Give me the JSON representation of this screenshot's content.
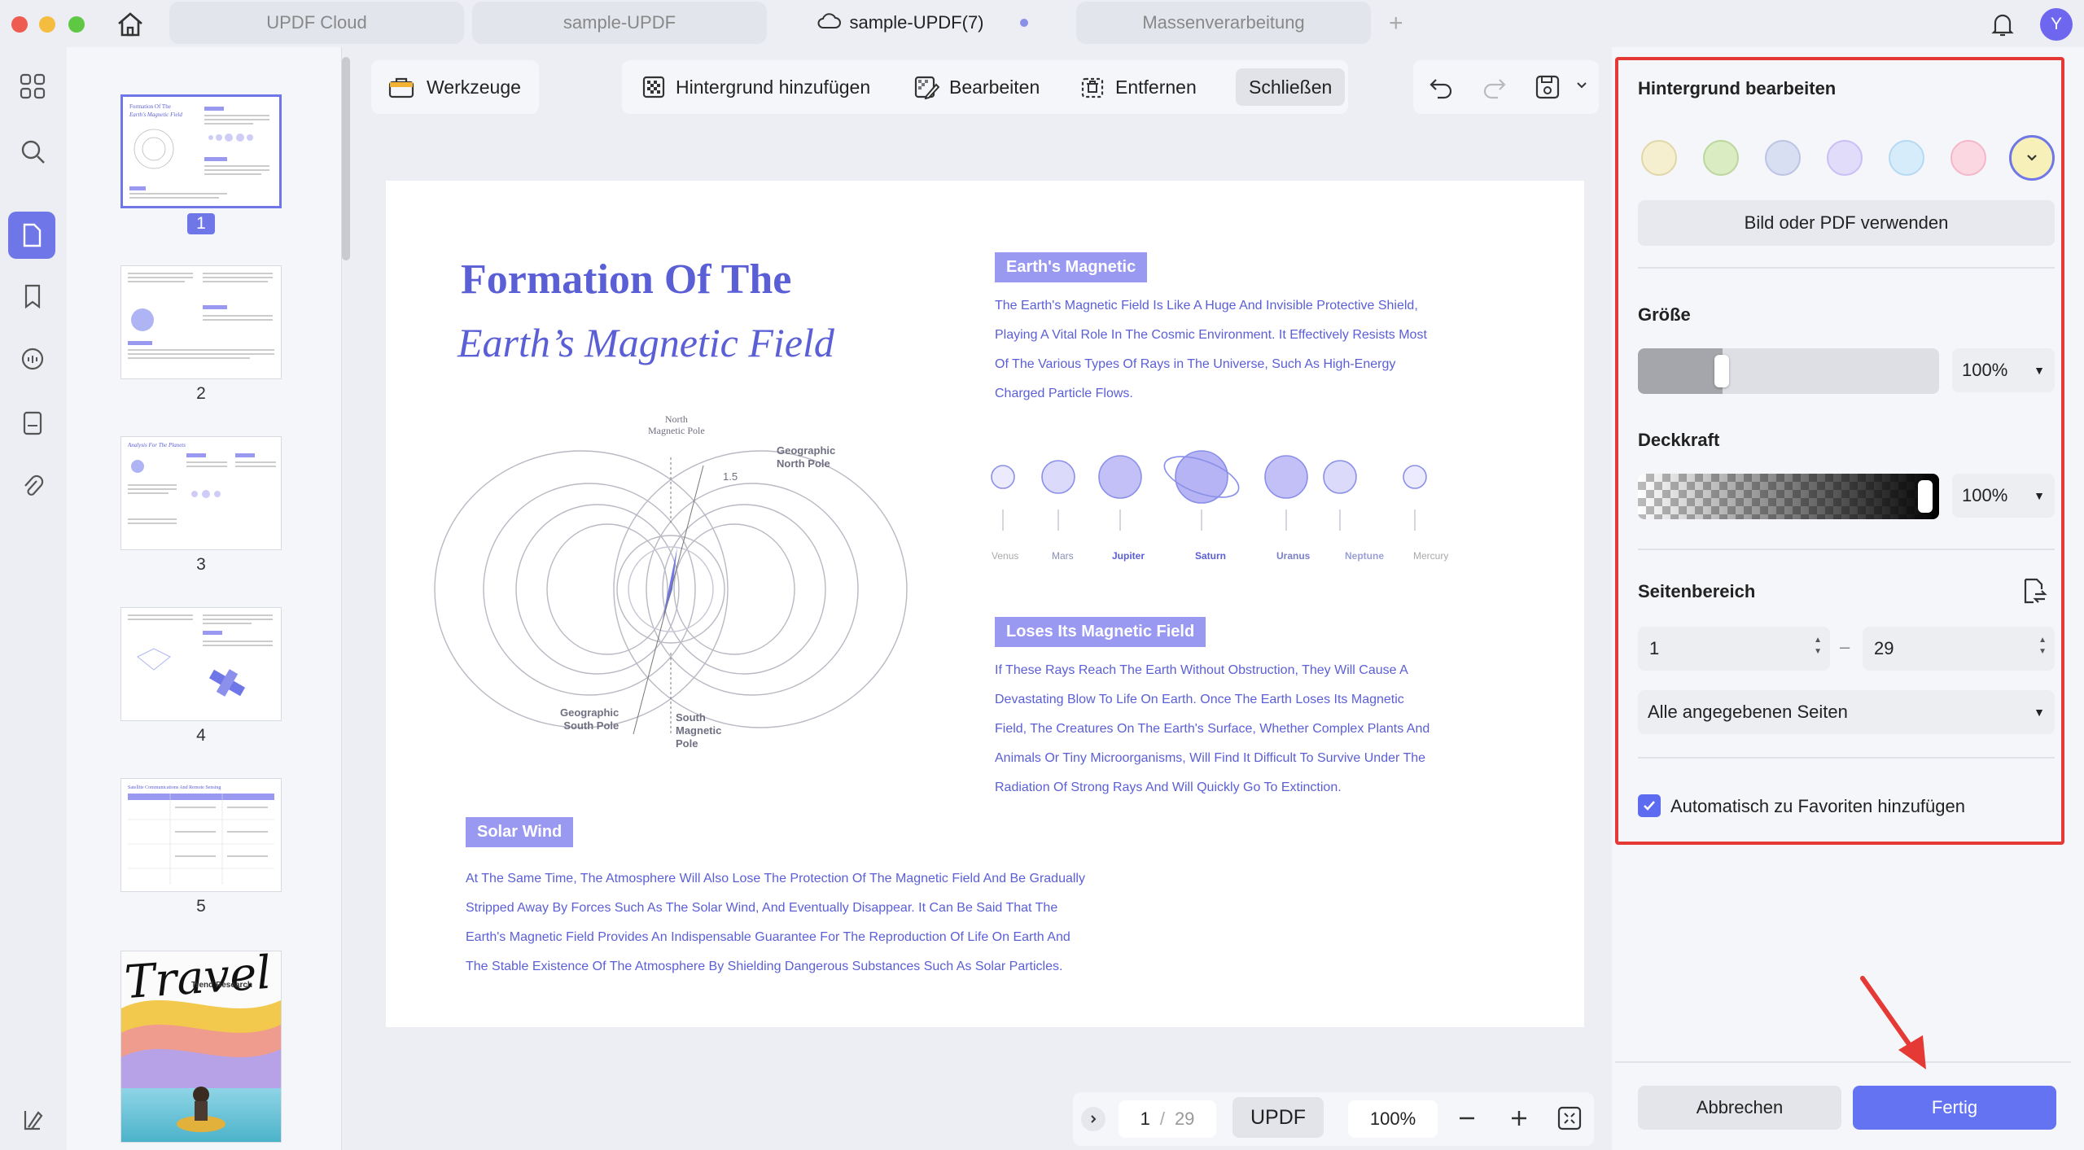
{
  "tabs": [
    {
      "label": "UPDF Cloud"
    },
    {
      "label": "sample-UPDF"
    },
    {
      "label": "sample-UPDF(7)"
    },
    {
      "label": "Massenverarbeitung"
    }
  ],
  "user_avatar": "Y",
  "thumbnails": [
    {
      "num": "1"
    },
    {
      "num": "2"
    },
    {
      "num": "3"
    },
    {
      "num": "4"
    },
    {
      "num": "5"
    }
  ],
  "thumb6_title": "Travel",
  "thumb6_subtitle": "Trend Research",
  "toolbar": {
    "tools": "Werkzeuge",
    "add_bg": "Hintergrund hinzufügen",
    "edit": "Bearbeiten",
    "remove": "Entfernen",
    "close": "Schließen"
  },
  "doc": {
    "title1": "Formation Of The",
    "title2": "Earth’s Magnetic Field",
    "pill1": "Earth's Magnetic",
    "para1": [
      "The Earth's Magnetic Field Is Like A Huge And Invisible Protective Shield,",
      "Playing A Vital Role In The Cosmic Environment. It Effectively Resists Most",
      "Of The Various Types Of Rays in The Universe, Such As High-Energy",
      "Charged Particle Flows."
    ],
    "planets": [
      "Venus",
      "Mars",
      "Jupiter",
      "Saturn",
      "Uranus",
      "Neptune",
      "Mercury"
    ],
    "pill2": "Loses Its Magnetic Field",
    "para2": [
      "If These Rays Reach The Earth Without Obstruction, They Will Cause A",
      "Devastating Blow To Life On Earth. Once The Earth Loses Its Magnetic",
      "Field, The Creatures On The Earth's Surface, Whether Complex Plants And",
      "Animals Or Tiny Microorganisms, Will Find It Difficult To Survive Under The",
      "Radiation Of Strong Rays And Will Quickly Go To Extinction."
    ],
    "pill3": "Solar Wind",
    "para3": [
      "At The Same Time, The Atmosphere Will Also Lose The Protection Of The Magnetic Field And Be Gradually",
      "Stripped Away By Forces Such As The Solar Wind, And Eventually Disappear. It Can Be Said That The",
      "Earth's Magnetic Field Provides An Indispensable Guarantee For The Reproduction Of Life On Earth And",
      "The Stable Existence Of The Atmosphere By Shielding Dangerous Substances Such As Solar Particles."
    ],
    "diagram": {
      "north_mag": "North\nMagnetic Pole",
      "geo_north": "Geographic\nNorth Pole",
      "angle": "1.5",
      "geo_south": "Geographic\nSouth Pole",
      "south_mag": "South\nMagnetic\nPole"
    }
  },
  "panel": {
    "title": "Hintergrund bearbeiten",
    "swatch_colors": [
      "#f6efcf",
      "#d9ecc2",
      "#d9dff2",
      "#e2dcfb",
      "#d6ecfb",
      "#fbd7e2",
      "#f7f0b8"
    ],
    "use_file": "Bild oder PDF verwenden",
    "size_label": "Größe",
    "size_value": "100%",
    "size_level": 0.2,
    "opacity_label": "Deckkraft",
    "opacity_value": "100%",
    "opacity_level": 1.0,
    "range_label": "Seitenbereich",
    "range_from": "1",
    "range_to": "29",
    "range_sep": "–",
    "range_select": "Alle angegebenen Seiten",
    "favorites": "Automatisch zu Favoriten hinzufügen",
    "favorites_checked": true
  },
  "footer": {
    "cancel": "Abbrechen",
    "done": "Fertig"
  },
  "pagebar": {
    "current": "1",
    "sep": "/",
    "total": "29",
    "brand": "UPDF",
    "zoom": "100%"
  }
}
